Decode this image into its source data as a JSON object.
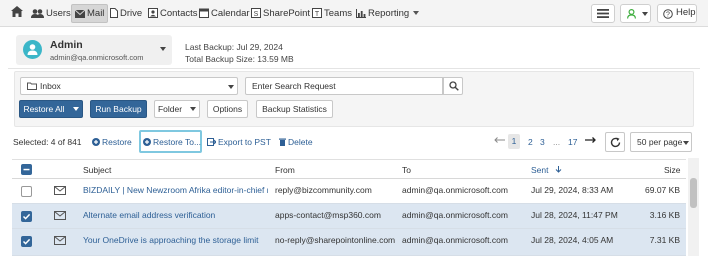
{
  "nav": {
    "items": [
      {
        "label": "Users",
        "icon": "users-icon"
      },
      {
        "label": "Mail",
        "icon": "envelope-icon"
      },
      {
        "label": "Drive",
        "icon": "file-icon"
      },
      {
        "label": "Contacts",
        "icon": "contacts-icon"
      },
      {
        "label": "Calendar",
        "icon": "calendar-icon"
      },
      {
        "label": "SharePoint",
        "icon": "sharepoint-icon"
      },
      {
        "label": "Teams",
        "icon": "teams-icon"
      },
      {
        "label": "Reporting",
        "icon": "chart-icon"
      }
    ],
    "active": "Mail",
    "help_label": "Help",
    "accent": "#336699",
    "user_status_color": "#3fae3f"
  },
  "account": {
    "name": "Admin",
    "email": "admin@qa.onmicrosoft.com",
    "last_backup": "Last Backup: Jul 29, 2024",
    "total_backup_size": "Total Backup Size: 13.59 MB"
  },
  "toolbar": {
    "folder_value": "Inbox",
    "search_placeholder": "Enter Search Request",
    "restore_all": "Restore All",
    "run_backup": "Run Backup",
    "folder": "Folder",
    "options": "Options",
    "backup_statistics": "Backup Statistics"
  },
  "actions": {
    "selected": "Selected: 4 of 841",
    "restore": "Restore",
    "restore_to": "Restore To...",
    "export_pst": "Export to PST",
    "delete": "Delete"
  },
  "pagination": {
    "pages": [
      "1",
      "2",
      "3",
      "...",
      "17"
    ],
    "current": "1",
    "per_page": "50 per page"
  },
  "table": {
    "columns": [
      "Subject",
      "From",
      "To",
      "Sent",
      "Size"
    ],
    "sorted_by": "Sent",
    "rows": [
      {
        "selected": false,
        "subject": "BIZDAILY | New Newzroom Afrika editor-in-chief n...",
        "from": "reply@bizcommunity.com",
        "to": "admin@qa.onmicrosoft.com",
        "sent": "Jul 29, 2024, 8:33 AM",
        "size": "69.07 KB"
      },
      {
        "selected": true,
        "subject": "Alternate email address verification",
        "from": "apps-contact@msp360.com",
        "to": "admin@qa.onmicrosoft.com",
        "sent": "Jul 28, 2024, 11:47 PM",
        "size": "3.16 KB"
      },
      {
        "selected": true,
        "subject": "Your OneDrive is approaching the storage limit",
        "from": "no-reply@sharepointonline.com",
        "to": "admin@qa.onmicrosoft.com",
        "sent": "Jul 28, 2024, 4:05 AM",
        "size": "7.31 KB"
      }
    ]
  }
}
